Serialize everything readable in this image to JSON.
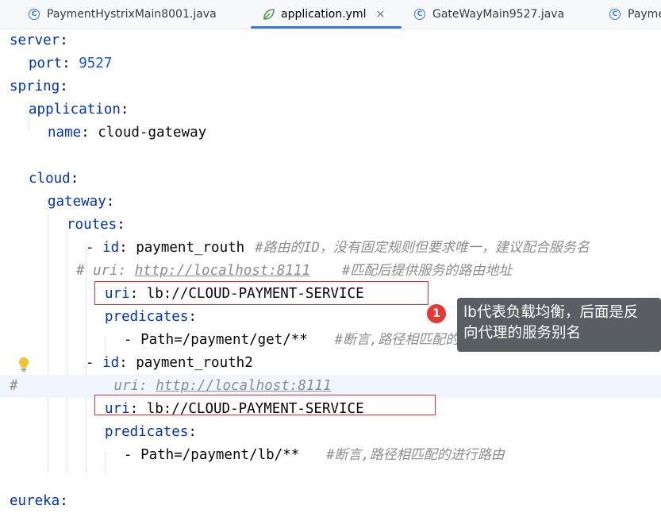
{
  "tabs": [
    {
      "label": "PaymentHystrixMain8001.java",
      "icon": "class-icon"
    },
    {
      "label": "application.yml",
      "icon": "spring-leaf-icon",
      "active": true,
      "close": "×"
    },
    {
      "label": "GateWayMain9527.java",
      "icon": "class-icon"
    },
    {
      "label": "Payme",
      "icon": "class-icon"
    }
  ],
  "class_icon_glyph": "C",
  "code": {
    "l1": {
      "key": "server",
      "colon": ":"
    },
    "l2": {
      "key": "port",
      "colon": ": ",
      "value": "9527"
    },
    "l3": {
      "key": "spring",
      "colon": ":"
    },
    "l4": {
      "key": "application",
      "colon": ":"
    },
    "l5": {
      "key": "name",
      "colon": ": ",
      "value": "cloud-gateway"
    },
    "l7": {
      "key": "cloud",
      "colon": ":"
    },
    "l8": {
      "key": "gateway",
      "colon": ":"
    },
    "l9": {
      "key": "routes",
      "colon": ":"
    },
    "l10": {
      "dash": "- ",
      "key": "id",
      "colon": ": ",
      "value": "payment_routh",
      "comment": "#路由的ID，没有固定规则但要求唯一，建议配合服务名"
    },
    "l11": {
      "hash": "# ",
      "key": "uri",
      "colon": ": ",
      "url": "http://localhost:8111",
      "comment": "#匹配后提供服务的路由地址"
    },
    "l12": {
      "key": "uri",
      "colon": ": ",
      "value": "lb://CLOUD-PAYMENT-SERVICE"
    },
    "l13": {
      "key": "predicates",
      "colon": ":"
    },
    "l14": {
      "dash": "- ",
      "value": "Path=/payment/get/**",
      "comment": "#断言,路径相匹配的进行路由"
    },
    "l15": {
      "dash": "- ",
      "key": "id",
      "colon": ": ",
      "value": "payment_routh2"
    },
    "l16": {
      "hash": "#",
      "key": "uri",
      "colon": ": ",
      "url": "http://localhost:8111"
    },
    "l17": {
      "key": "uri",
      "colon": ": ",
      "value": "lb://CLOUD-PAYMENT-SERVICE"
    },
    "l18": {
      "key": "predicates",
      "colon": ":"
    },
    "l19": {
      "dash": "- ",
      "value": "Path=/payment/lb/**",
      "comment": "#断言,路径相匹配的进行路由"
    },
    "l21": {
      "key": "eureka",
      "colon": ":"
    }
  },
  "annotation": {
    "badge": "1",
    "tooltip_line1": "lb代表负载均衡，后面是反",
    "tooltip_line2": "向代理的服务别名"
  },
  "colors": {
    "key": "#0033b3",
    "number": "#1750eb",
    "comment": "#8c8c8c",
    "highlight_box": "#e0323a",
    "tab_accent": "#3574f0",
    "tooltip_bg": "#5a5d62"
  }
}
